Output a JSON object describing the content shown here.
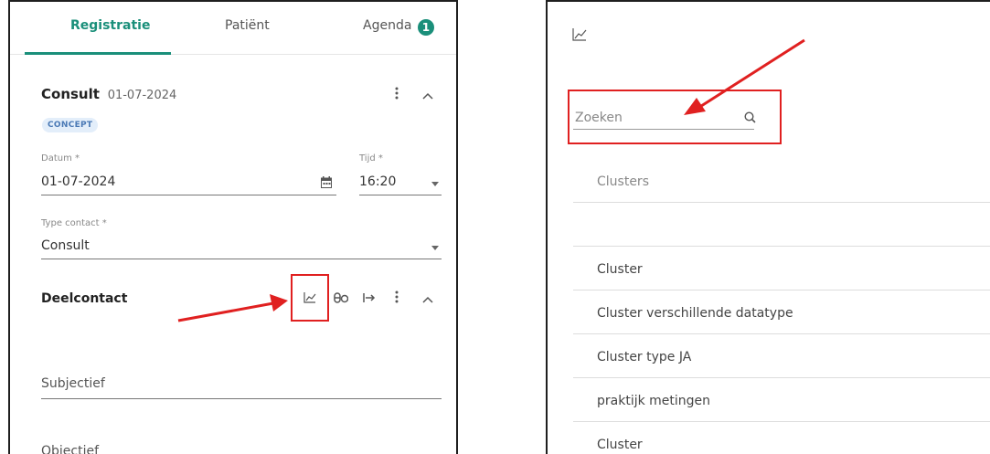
{
  "left": {
    "tabs": [
      {
        "label": "Registratie"
      },
      {
        "label": "Patiënt"
      },
      {
        "label": "Agenda",
        "badge": "1"
      }
    ],
    "consult": {
      "title": "Consult",
      "date": "01-07-2024",
      "status": "CONCEPT"
    },
    "fields": {
      "datum_label": "Datum *",
      "datum_value": "01-07-2024",
      "tijd_label": "Tijd *",
      "tijd_value": "16:20",
      "type_contact_label": "Type contact *",
      "type_contact_value": "Consult",
      "subjectief": "Subjectief",
      "objectief": "Objectief"
    },
    "deelcontact": {
      "title": "Deelcontact"
    }
  },
  "right": {
    "search": {
      "placeholder": "Zoeken"
    },
    "list_header": "Clusters",
    "items": [
      "",
      "Cluster",
      "Cluster verschillende datatype",
      "Cluster type JA",
      "praktijk metingen",
      "Cluster"
    ]
  },
  "colors": {
    "accent": "#1a8f7a",
    "highlight": "#e02020",
    "concept_bg": "#e3eefa",
    "concept_text": "#4a79b5"
  },
  "icons": [
    "chart-icon",
    "pills-icon",
    "arrow-to-right-icon",
    "more-vertical-icon",
    "chevron-up-icon",
    "calendar-icon",
    "caret-down-icon",
    "search-icon"
  ]
}
